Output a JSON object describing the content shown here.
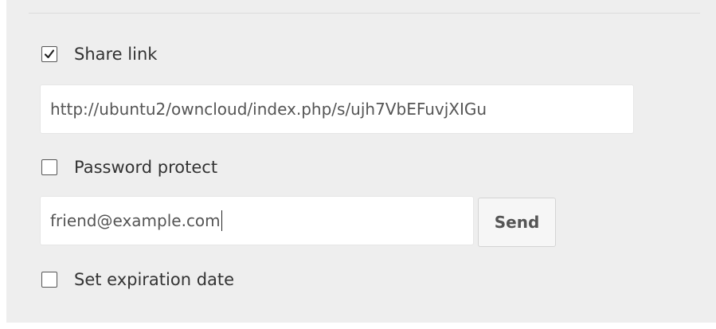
{
  "share_link": {
    "label": "Share link",
    "checked": true
  },
  "link_field": {
    "value": "http://ubuntu2/owncloud/index.php/s/ujh7VbEFuvjXIGu"
  },
  "password_protect": {
    "label": "Password protect",
    "checked": false
  },
  "email_field": {
    "value": "friend@example.com"
  },
  "send_button": {
    "label": "Send"
  },
  "expiration": {
    "label": "Set expiration date",
    "checked": false
  },
  "icons": {
    "checked": "checkmark-icon"
  }
}
